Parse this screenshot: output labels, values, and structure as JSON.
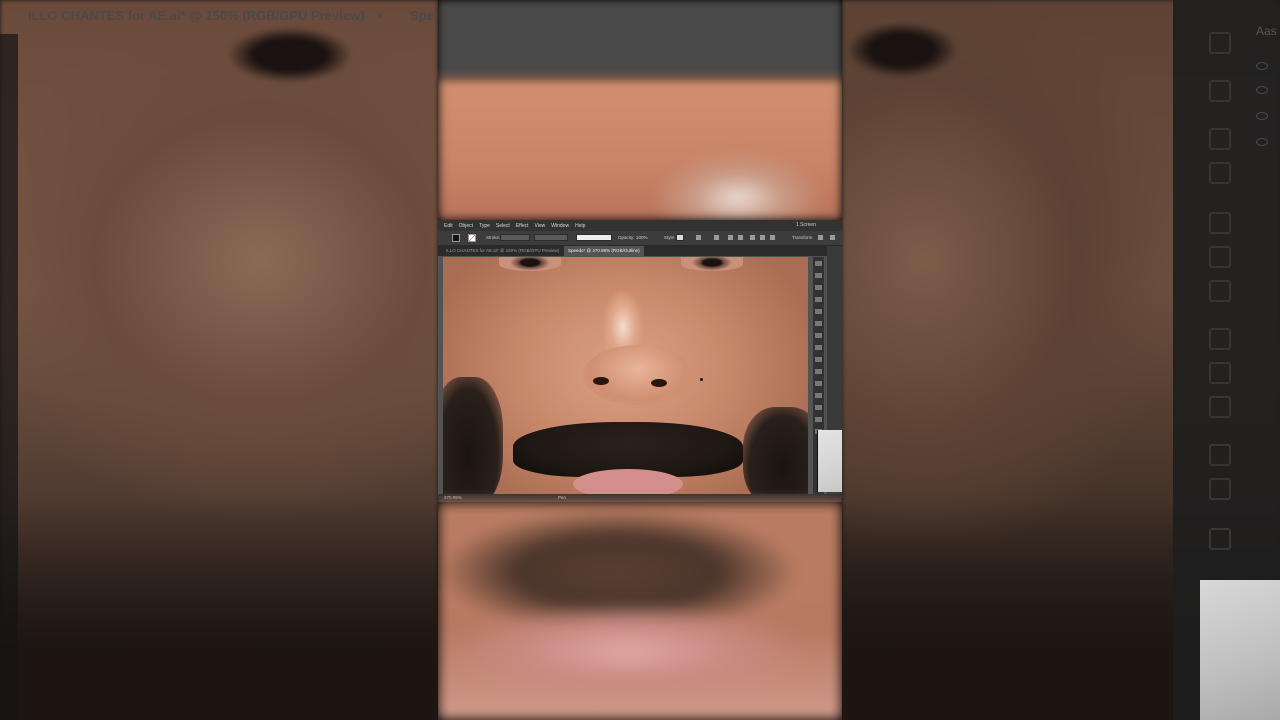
{
  "background": {
    "document_tabs": [
      {
        "title": "ILLO CHANTES for AE.ai* @ 150% (RGB/GPU Preview)",
        "close": "×"
      },
      {
        "title": "Spe"
      }
    ],
    "panel_label": "Aas"
  },
  "app": {
    "menu": [
      "Edit",
      "Object",
      "Type",
      "Select",
      "Effect",
      "View",
      "Window",
      "Help"
    ],
    "workspace": "1 Screen",
    "control_bar": {
      "stroke_label": "Stroke:",
      "opacity_label": "Opacity:",
      "opacity_value": "100%",
      "style_label": "Style:",
      "transform_label": "Transform"
    },
    "tabs": [
      {
        "title": "ILLO CHANTES for AE.ai* @ 150% (RGB/GPU Preview)",
        "active": false
      },
      {
        "title": "Speedo* @ 270.99% (RGB/Outline)",
        "active": true
      }
    ],
    "status": {
      "zoom": "270.99%",
      "tool": "Pen"
    }
  },
  "colors": {
    "ui_dark": "#323232",
    "ui_mid": "#535353",
    "accent_blue": "#3e6ea8"
  }
}
